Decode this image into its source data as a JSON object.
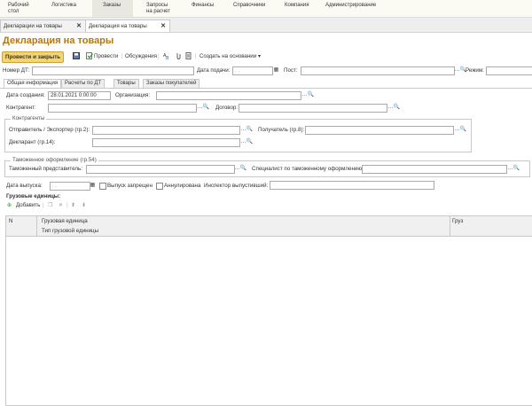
{
  "nav": {
    "items": [
      {
        "label": "Рабочий\nстол"
      },
      {
        "label": "Логистика"
      },
      {
        "label": "Заказы"
      },
      {
        "label": "Запросы\nна расчет"
      },
      {
        "label": "Финансы"
      },
      {
        "label": "Справочники"
      },
      {
        "label": "Компания"
      },
      {
        "label": "Администрирование"
      }
    ]
  },
  "window_tabs": [
    {
      "label": "Декларации на товары"
    },
    {
      "label": "Декларация на товары"
    }
  ],
  "form": {
    "title": "Декларация на товары",
    "toolbar": {
      "post_close": "Провести и закрыть",
      "post": "Провести",
      "discussions": "Обсуждения",
      "create_basis": "Создать на основании"
    },
    "header": {
      "number_label": "Номер ДТ:",
      "number_value": "",
      "date_label": "Дата подачи:",
      "date_value": ". .",
      "post_label": "Пост:",
      "post_value": "",
      "mode_label": "Режим:",
      "mode_value": ""
    },
    "tabs": [
      {
        "label": "Общая информация"
      },
      {
        "label": "Расчеты по ДТ"
      },
      {
        "label": "Товары"
      },
      {
        "label": "Заказы покупателей"
      }
    ],
    "general": {
      "created_label": "Дата создания:",
      "created_value": "28.01.2021  0:00:00",
      "org_label": "Организация:",
      "org_value": "",
      "counterparty_label": "Контрагент:",
      "counterparty_value": "",
      "contract_label": "Договор:",
      "contract_value": ""
    },
    "counterparties": {
      "group_label": "Контрагенты",
      "sender_label": "Отправитель / Экспортер (гр.2):",
      "sender_value": "",
      "receiver_label": "Получатель (гр.8):",
      "receiver_value": "",
      "declarant_label": "Декларант (гр.14):",
      "declarant_value": ""
    },
    "customs": {
      "group_label": "Таможенное оформление (гр.54)",
      "rep_label": "Таможенный представитель:",
      "rep_value": "",
      "spec_label": "Специалист по таможенному оформлению:",
      "spec_value": ""
    },
    "release": {
      "date_label": "Дата выпуска:",
      "date_value": ". .",
      "forbidden_label": "Выпуск запрещен",
      "forbidden_checked": false,
      "annulled_label": "Аннулирована",
      "annulled_checked": false,
      "inspector_label": "Инспектор выпустивший:",
      "inspector_value": ""
    },
    "cargo": {
      "section_label": "Грузовые единицы:",
      "add_label": "Добавить",
      "columns": {
        "n": "N",
        "unit": "Грузовая единица",
        "unit_type": "Тип грузовой единицы",
        "cargo": "Груз"
      },
      "rows": []
    }
  },
  "colors": {
    "accent": "#b37810",
    "primary_button": "#f3d472"
  }
}
